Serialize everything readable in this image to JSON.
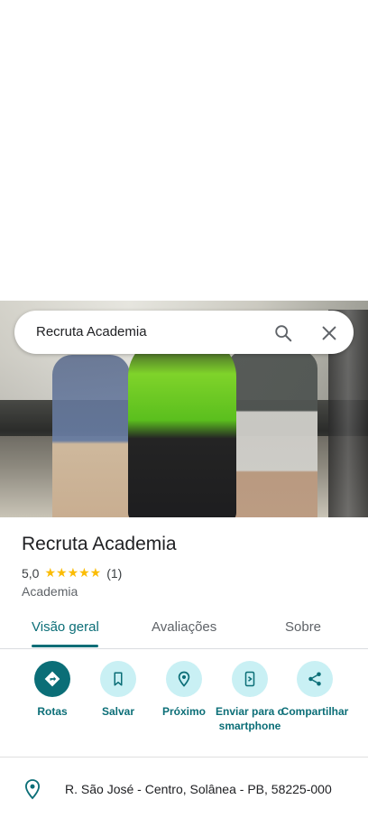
{
  "search": {
    "query": "Recruta Academia"
  },
  "place": {
    "name": "Recruta Academia",
    "rating": "5,0",
    "stars": "★★★★★",
    "review_count": "(1)",
    "category": "Academia"
  },
  "tabs": [
    {
      "label": "Visão geral",
      "active": true
    },
    {
      "label": "Avaliações",
      "active": false
    },
    {
      "label": "Sobre",
      "active": false
    }
  ],
  "actions": [
    {
      "label": "Rotas",
      "icon": "directions-icon"
    },
    {
      "label": "Salvar",
      "icon": "bookmark-icon"
    },
    {
      "label": "Próximo",
      "icon": "nearby-icon"
    },
    {
      "label": "Enviar para o smartphone",
      "icon": "send-to-phone-icon"
    },
    {
      "label": "Compartilhar",
      "icon": "share-icon"
    }
  ],
  "address": "R. São José - Centro, Solânea - PB, 58225-000",
  "colors": {
    "accent": "#0b6e77",
    "accent_light": "#c9f0f4",
    "star": "#fbbc04"
  }
}
